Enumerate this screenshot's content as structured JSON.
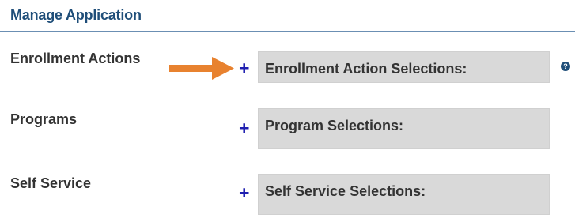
{
  "header": {
    "title": "Manage Application"
  },
  "rows": [
    {
      "label": "Enrollment Actions",
      "box_label": "Enrollment Action Selections:",
      "add_symbol": "+"
    },
    {
      "label": "Programs",
      "box_label": "Program Selections:",
      "add_symbol": "+"
    },
    {
      "label": "Self Service",
      "box_label": "Self Service Selections:",
      "add_symbol": "+"
    }
  ],
  "help_icon": {
    "symbol": "?",
    "icon": "question-circle-icon"
  },
  "colors": {
    "header_text": "#1f4e79",
    "accent_arrow": "#e8822f",
    "plus": "#1f1fb0",
    "box_bg": "#d9d9d9"
  }
}
